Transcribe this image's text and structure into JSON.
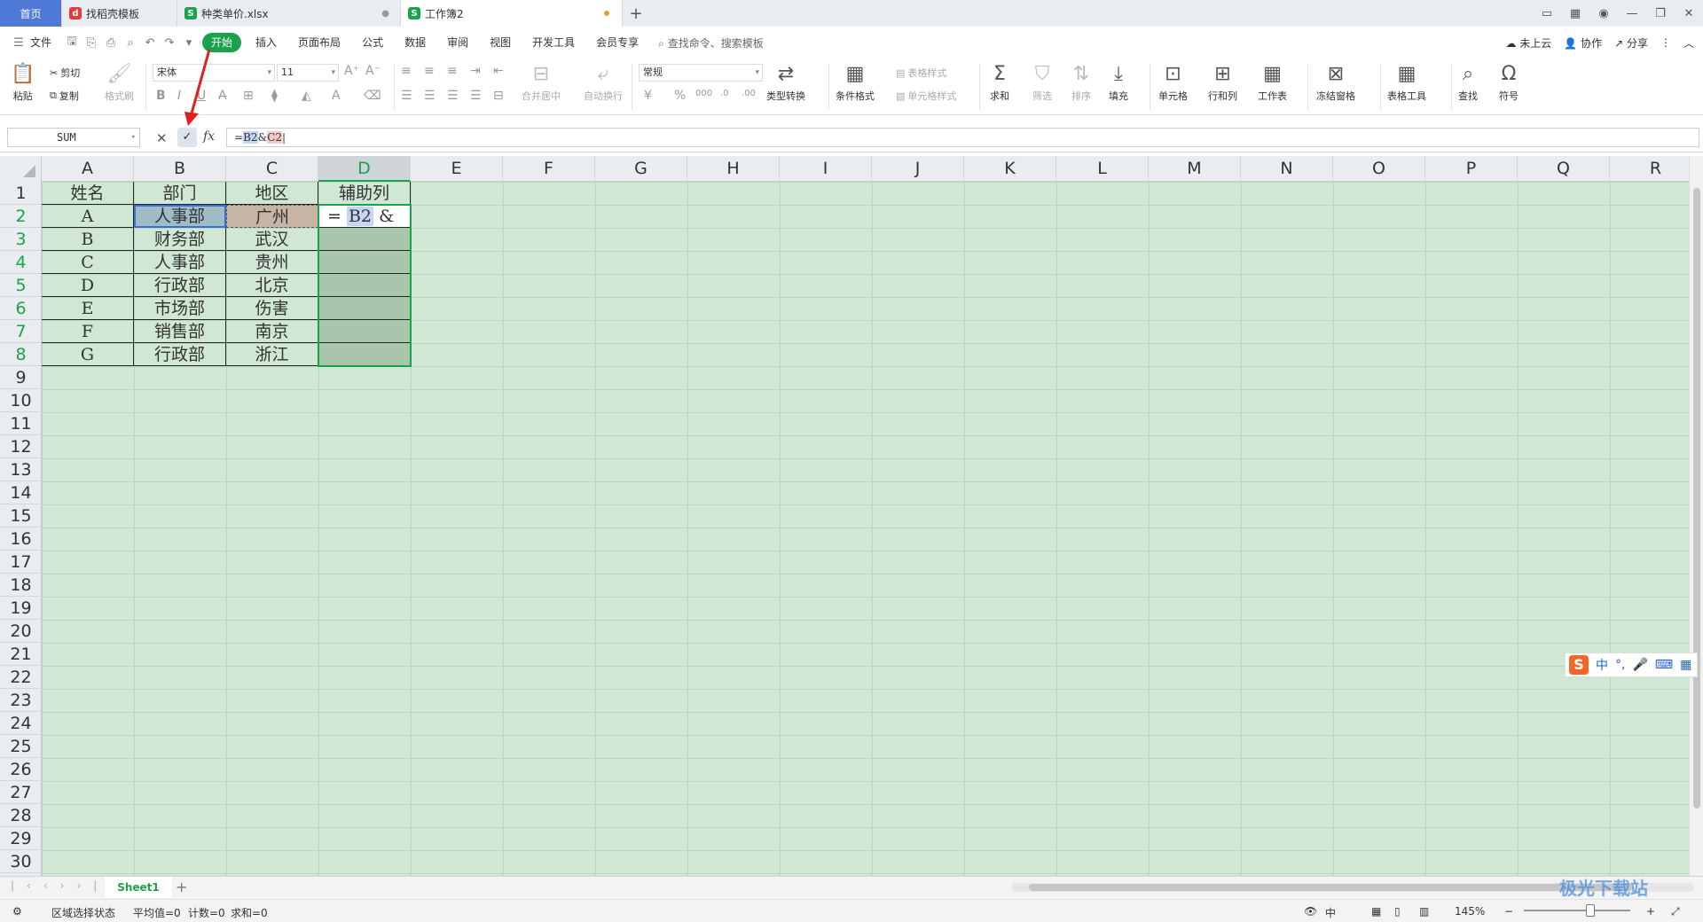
{
  "tabs": [
    {
      "label": "首页"
    },
    {
      "label": "找稻壳模板"
    },
    {
      "label": "种类单价.xlsx"
    },
    {
      "label": "工作簿2"
    }
  ],
  "menu": {
    "file": "文件",
    "items": [
      "开始",
      "插入",
      "页面布局",
      "公式",
      "数据",
      "审阅",
      "视图",
      "开发工具",
      "会员专享"
    ],
    "search": "查找命令、搜索模板",
    "right": [
      "未上云",
      "协作",
      "分享"
    ]
  },
  "ribbon": {
    "paste": "粘贴",
    "cut": "剪切",
    "copy": "复制",
    "format_painter": "格式刷",
    "font_name": "宋体",
    "font_size": "11",
    "merge": "合并居中",
    "wrap": "自动换行",
    "num_format": "常规",
    "type_convert": "类型转换",
    "cond_format": "条件格式",
    "table_style": "表格样式",
    "cell_style": "单元格样式",
    "sum": "求和",
    "filter": "筛选",
    "sort": "排序",
    "fill": "填充",
    "cell": "单元格",
    "rowcol": "行和列",
    "sheet": "工作表",
    "freeze": "冻结窗格",
    "table_tools": "表格工具",
    "find": "查找",
    "symbol": "符号"
  },
  "formula_bar": {
    "name_box": "SUM",
    "fx": "fx",
    "formula_prefix": "=",
    "ref1": "B2",
    "amp": "&",
    "ref2": "C2"
  },
  "columns": [
    "A",
    "B",
    "C",
    "D",
    "E",
    "F",
    "G",
    "H",
    "I",
    "J",
    "K",
    "L",
    "M",
    "N",
    "O",
    "P",
    "Q",
    "R"
  ],
  "rows": [
    "1",
    "2",
    "3",
    "4",
    "5",
    "6",
    "7",
    "8",
    "9",
    "10",
    "11",
    "12",
    "13",
    "14",
    "15",
    "16",
    "17",
    "18",
    "19",
    "20",
    "21",
    "22",
    "23",
    "24",
    "25",
    "26",
    "27",
    "28",
    "29",
    "30"
  ],
  "table": {
    "header": [
      "姓名",
      "部门",
      "地区",
      "辅助列"
    ],
    "rows": [
      [
        "A",
        "人事部",
        "广州"
      ],
      [
        "B",
        "财务部",
        "武汉"
      ],
      [
        "C",
        "人事部",
        "贵州"
      ],
      [
        "D",
        "行政部",
        "北京"
      ],
      [
        "E",
        "市场部",
        "伤害"
      ],
      [
        "F",
        "销售部",
        "南京"
      ],
      [
        "G",
        "行政部",
        "浙江"
      ]
    ],
    "edit_cell": {
      "prefix": "=",
      "ref1": "B2",
      "amp": "&",
      "ref2": "C2"
    }
  },
  "ime": {
    "label": "中"
  },
  "sheet": {
    "name": "Sheet1"
  },
  "status": {
    "mode": "区域选择状态",
    "avg": "平均值=0",
    "count": "计数=0",
    "sum": "求和=0",
    "input": "中",
    "zoom": "145%"
  },
  "watermark": "极光下载站",
  "colors": {
    "accent": "#1ba24c",
    "grid_bg": "#cfe7d3",
    "home_tab": "#4e79d6",
    "arrow": "#e02020"
  }
}
